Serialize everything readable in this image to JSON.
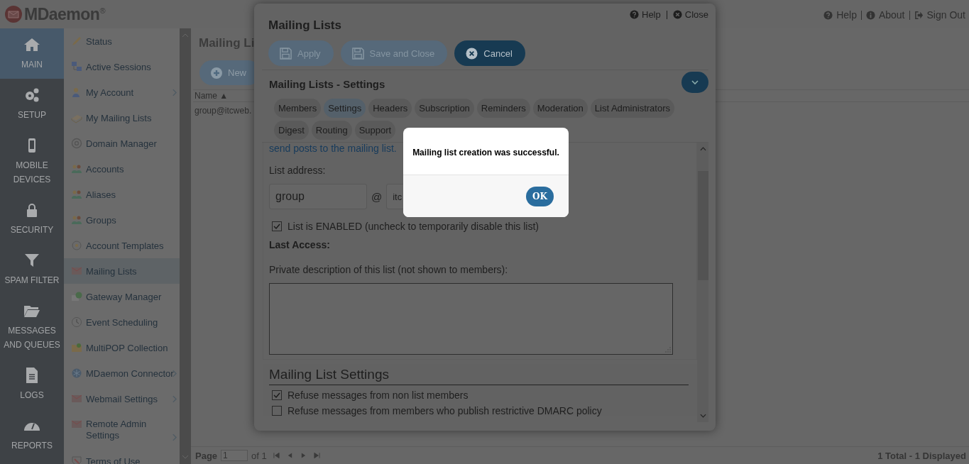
{
  "header": {
    "logo": "MDaemon",
    "logo_mark": "®",
    "links": [
      "Help",
      "About",
      "Sign Out"
    ]
  },
  "nav": [
    {
      "label": "MAIN",
      "selected": true
    },
    {
      "label": "SETUP",
      "selected": false
    },
    {
      "label": "MOBILE DEVICES",
      "selected": false
    },
    {
      "label": "SECURITY",
      "selected": false
    },
    {
      "label": "SPAM FILTER",
      "selected": false
    },
    {
      "label": "MESSAGES AND QUEUES",
      "selected": false
    },
    {
      "label": "LOGS",
      "selected": false
    },
    {
      "label": "REPORTS",
      "selected": false
    }
  ],
  "submenu": [
    {
      "label": "Status",
      "selected": false,
      "has_submenu": false
    },
    {
      "label": "Active Sessions",
      "selected": false,
      "has_submenu": false
    },
    {
      "label": "My Account",
      "selected": false,
      "has_submenu": true
    },
    {
      "label": "My Mailing Lists",
      "selected": false,
      "has_submenu": false
    },
    {
      "label": "Domain Manager",
      "selected": false,
      "has_submenu": false
    },
    {
      "label": "Accounts",
      "selected": false,
      "has_submenu": false
    },
    {
      "label": "Aliases",
      "selected": false,
      "has_submenu": false
    },
    {
      "label": "Groups",
      "selected": false,
      "has_submenu": false
    },
    {
      "label": "Account Templates",
      "selected": false,
      "has_submenu": false
    },
    {
      "label": "Mailing Lists",
      "selected": true,
      "has_submenu": false
    },
    {
      "label": "Gateway Manager",
      "selected": false,
      "has_submenu": false
    },
    {
      "label": "Event Scheduling",
      "selected": false,
      "has_submenu": false
    },
    {
      "label": "MultiPOP Collection",
      "selected": false,
      "has_submenu": false
    },
    {
      "label": "MDaemon Connector",
      "selected": false,
      "has_submenu": true
    },
    {
      "label": "Webmail Settings",
      "selected": false,
      "has_submenu": true
    },
    {
      "label": "Remote Admin Settings",
      "selected": false,
      "has_submenu": true
    },
    {
      "label": "Terms of Use",
      "selected": false,
      "has_submenu": false
    }
  ],
  "content": {
    "title": "Mailing Li",
    "new_button": "New",
    "column": "Name",
    "sort_mark": "▲",
    "rows": [
      "group@itcweb."
    ],
    "pager": {
      "label": "Page",
      "page": "1",
      "of": "of 1"
    },
    "summary": "1 Total - 1 Displayed"
  },
  "modal": {
    "title": "Mailing Lists",
    "links": [
      "Help",
      "Close"
    ],
    "buttons": [
      {
        "label": "Apply",
        "kind": "save",
        "disabled": true
      },
      {
        "label": "Save and Close",
        "kind": "save",
        "disabled": true
      },
      {
        "label": "Cancel",
        "kind": "cancel",
        "disabled": false
      }
    ],
    "section_title": "Mailing Lists - Settings",
    "tabs": [
      [
        {
          "label": "Members",
          "selected": false
        },
        {
          "label": "Settings",
          "selected": true
        },
        {
          "label": "Headers",
          "selected": false
        },
        {
          "label": "Subscription",
          "selected": false
        },
        {
          "label": "Reminders",
          "selected": false
        },
        {
          "label": "Moderation",
          "selected": false
        },
        {
          "label": "List Administrators",
          "selected": false
        }
      ],
      [
        {
          "label": "Digest",
          "selected": false
        },
        {
          "label": "Routing",
          "selected": false
        },
        {
          "label": "Support",
          "selected": false
        }
      ]
    ],
    "intro_tail": "send posts to the mailing list.",
    "address_label": "List address:",
    "local_part": "group",
    "at": "@",
    "domain": "itc",
    "enabled": {
      "label": "List is ENABLED (uncheck to temporarily disable this list)",
      "checked": true
    },
    "last_access_label": "Last Access:",
    "description_label": "Private description of this list (not shown to members):",
    "settings_heading": "Mailing List Settings",
    "options": [
      {
        "label": "Refuse messages from non list members",
        "checked": true
      },
      {
        "label": "Refuse messages from members who publish restrictive DMARC policy",
        "checked": false
      }
    ]
  },
  "alert": {
    "message": "Mailing list creation was successful.",
    "button": "OK"
  }
}
